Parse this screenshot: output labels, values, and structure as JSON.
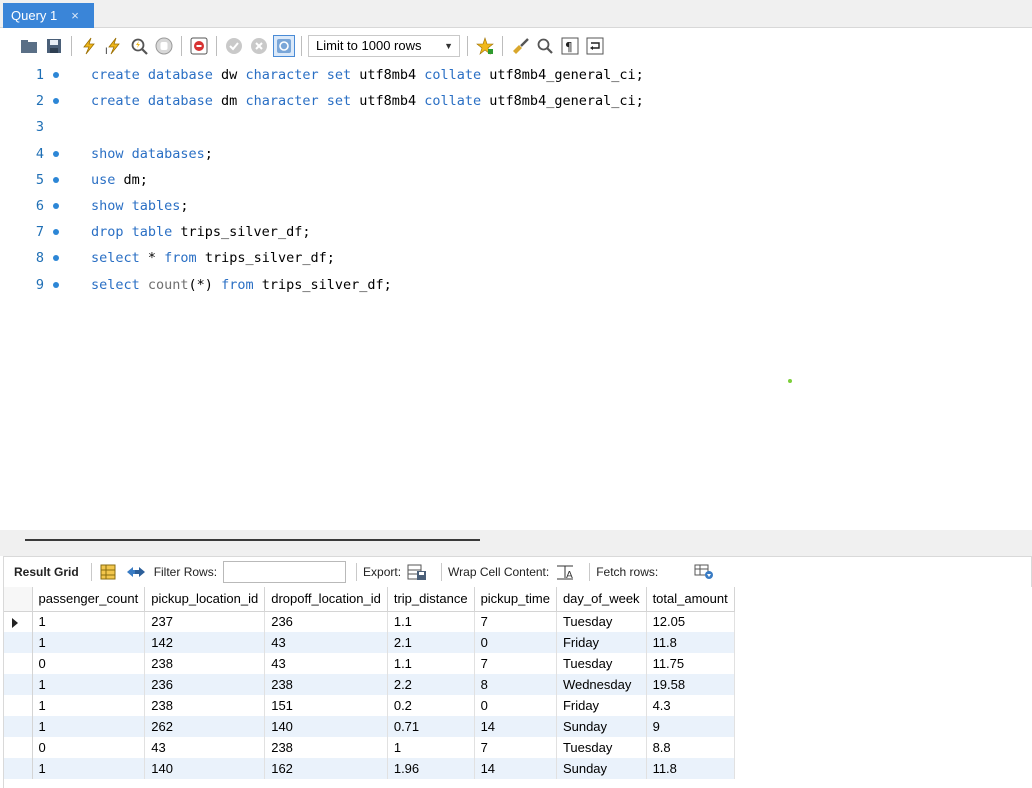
{
  "tab": {
    "title": "Query 1",
    "close": "×"
  },
  "toolbar": {
    "limit_value": "Limit to 1000 rows"
  },
  "editor": {
    "lines": [
      {
        "num": "1",
        "bullet": true,
        "tokens": [
          [
            "kw",
            "create database "
          ],
          [
            "id",
            "dw "
          ],
          [
            "kw",
            "character set "
          ],
          [
            "id",
            "utf8mb4 "
          ],
          [
            "kw",
            "collate "
          ],
          [
            "id",
            "utf8mb4_general_ci;"
          ]
        ]
      },
      {
        "num": "2",
        "bullet": true,
        "tokens": [
          [
            "kw",
            "create database "
          ],
          [
            "id",
            "dm "
          ],
          [
            "kw",
            "character set "
          ],
          [
            "id",
            "utf8mb4 "
          ],
          [
            "kw",
            "collate "
          ],
          [
            "id",
            "utf8mb4_general_ci;"
          ]
        ]
      },
      {
        "num": "3",
        "bullet": false,
        "tokens": []
      },
      {
        "num": "4",
        "bullet": true,
        "tokens": [
          [
            "kw",
            "show databases"
          ],
          [
            "id",
            ";"
          ]
        ]
      },
      {
        "num": "5",
        "bullet": true,
        "tokens": [
          [
            "kw",
            "use "
          ],
          [
            "id",
            "dm;"
          ]
        ]
      },
      {
        "num": "6",
        "bullet": true,
        "tokens": [
          [
            "kw",
            "show tables"
          ],
          [
            "id",
            ";"
          ]
        ]
      },
      {
        "num": "7",
        "bullet": true,
        "tokens": [
          [
            "kw",
            "drop table "
          ],
          [
            "id",
            "trips_silver_df;"
          ]
        ]
      },
      {
        "num": "8",
        "bullet": true,
        "tokens": [
          [
            "kw",
            "select "
          ],
          [
            "id",
            "* "
          ],
          [
            "kw",
            "from "
          ],
          [
            "id",
            "trips_silver_df;"
          ]
        ]
      },
      {
        "num": "9",
        "bullet": true,
        "tokens": [
          [
            "kw",
            "select "
          ],
          [
            "fn",
            "count"
          ],
          [
            "id",
            "(*) "
          ],
          [
            "kw",
            "from "
          ],
          [
            "id",
            "trips_silver_df;"
          ]
        ]
      }
    ]
  },
  "result_toolbar": {
    "result_grid": "Result Grid",
    "filter_rows": "Filter Rows:",
    "export": "Export:",
    "wrap_cell": "Wrap Cell Content:",
    "fetch_rows": "Fetch rows:"
  },
  "grid": {
    "columns": [
      "passenger_count",
      "pickup_location_id",
      "dropoff_location_id",
      "trip_distance",
      "pickup_time",
      "day_of_week",
      "total_amount"
    ],
    "rows": [
      [
        "1",
        "237",
        "236",
        "1.1",
        "7",
        "Tuesday",
        "12.05"
      ],
      [
        "1",
        "142",
        "43",
        "2.1",
        "0",
        "Friday",
        "11.8"
      ],
      [
        "0",
        "238",
        "43",
        "1.1",
        "7",
        "Tuesday",
        "11.75"
      ],
      [
        "1",
        "236",
        "238",
        "2.2",
        "8",
        "Wednesday",
        "19.58"
      ],
      [
        "1",
        "238",
        "151",
        "0.2",
        "0",
        "Friday",
        "4.3"
      ],
      [
        "1",
        "262",
        "140",
        "0.71",
        "14",
        "Sunday",
        "9"
      ],
      [
        "0",
        "43",
        "238",
        "1",
        "7",
        "Tuesday",
        "8.8"
      ],
      [
        "1",
        "140",
        "162",
        "1.96",
        "14",
        "Sunday",
        "11.8"
      ]
    ]
  }
}
